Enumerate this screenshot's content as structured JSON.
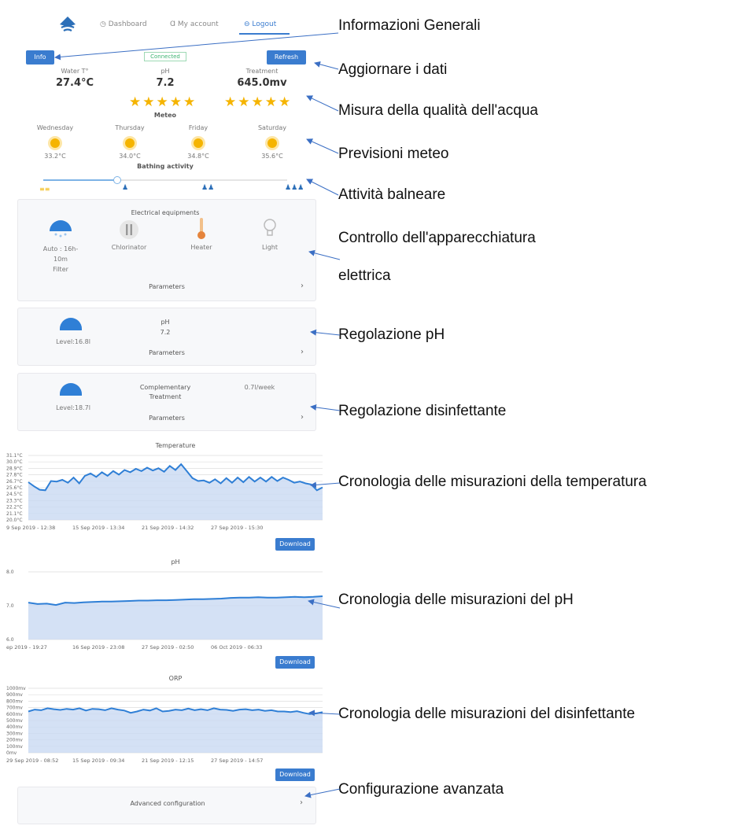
{
  "nav": {
    "dashboard": "Dashboard",
    "account": "My account",
    "logout": "Logout"
  },
  "top": {
    "info": "Info",
    "connected": "Connected",
    "refresh": "Refresh"
  },
  "measures": [
    {
      "label": "Water T°",
      "value": "27.4°C"
    },
    {
      "label": "pH",
      "value": "7.2"
    },
    {
      "label": "Treatment",
      "value": "645.0mv"
    }
  ],
  "stars": {
    "left": "★★★★★",
    "right": "★★★★★"
  },
  "meteo": {
    "title": "Meteo",
    "days": [
      {
        "name": "Wednesday",
        "temp": "33.2°C"
      },
      {
        "name": "Thursday",
        "temp": "34.0°C"
      },
      {
        "name": "Friday",
        "temp": "34.8°C"
      },
      {
        "name": "Saturday",
        "temp": "35.6°C"
      }
    ]
  },
  "bathing": {
    "title": "Bathing activity",
    "level": 0.3,
    "glyphs": [
      "≡≡",
      "♟",
      "♟♟",
      "♟♟♟"
    ]
  },
  "electrical": {
    "title": "Electrical equipments",
    "filter": {
      "line1": "Auto : 16h-",
      "line2": "10m",
      "line3": "Filter"
    },
    "chlorinator": "Chlorinator",
    "heater": "Heater",
    "light": "Light",
    "parameters": "Parameters"
  },
  "ph_panel": {
    "level": "Level:16.8l",
    "label": "pH",
    "value": "7.2",
    "parameters": "Parameters"
  },
  "treat_panel": {
    "level": "Level:18.7l",
    "label1": "Complementary",
    "label2": "Treatment",
    "rate": "0.7l/week",
    "parameters": "Parameters"
  },
  "download": "Download",
  "advanced": "Advanced configuration",
  "annotations": {
    "a1": "Informazioni Generali",
    "a2": "Aggiornare i dati",
    "a3": "Misura della qualità dell'acqua",
    "a4": "Previsioni meteo",
    "a5": "Attività balneare",
    "a6a": "Controllo dell'apparecchiatura",
    "a6b": "elettrica",
    "a7": "Regolazione pH",
    "a8": "Regolazione disinfettante",
    "a9": "Cronologia delle misurazioni della temperatura",
    "a10": "Cronologia delle misurazioni del pH",
    "a11": "Cronologia delle misurazioni del disinfettante",
    "a12": "Configurazione avanzata"
  },
  "chart_data": [
    {
      "type": "area",
      "title": "Temperature",
      "yticks": [
        "31.1°C",
        "30.0°C",
        "28.9°C",
        "27.8°C",
        "26.7°C",
        "25.6°C",
        "24.5°C",
        "23.3°C",
        "22.2°C",
        "21.1°C",
        "20.0°C"
      ],
      "ylim": [
        20.0,
        31.1
      ],
      "xticks": [
        "9 Sep 2019 - 12:38",
        "15 Sep 2019 - 13:34",
        "21 Sep 2019 - 14:32",
        "27 Sep 2019 - 15:30"
      ],
      "values": [
        26.5,
        25.8,
        25.2,
        25.1,
        26.7,
        26.6,
        26.9,
        26.4,
        27.3,
        26.3,
        27.6,
        28.0,
        27.4,
        28.2,
        27.6,
        28.4,
        27.8,
        28.6,
        28.2,
        28.8,
        28.4,
        29.0,
        28.5,
        28.9,
        28.3,
        29.3,
        28.6,
        29.6,
        28.4,
        27.2,
        26.7,
        26.8,
        26.4,
        27.0,
        26.3,
        27.2,
        26.4,
        27.3,
        26.5,
        27.4,
        26.6,
        27.3,
        26.6,
        27.4,
        26.7,
        27.3,
        26.9,
        26.4,
        26.6,
        26.3,
        26.1,
        25.1,
        25.6
      ]
    },
    {
      "type": "area",
      "title": "pH",
      "yticks": [
        "8.0",
        "7.0",
        "6.0"
      ],
      "ylim": [
        6.0,
        8.0
      ],
      "xticks": [
        "ep 2019 - 19:27",
        "16 Sep 2019 - 23:08",
        "27 Sep 2019 - 02:50",
        "06 Oct 2019 - 06:33"
      ],
      "values": [
        7.09,
        7.05,
        7.06,
        7.02,
        7.09,
        7.08,
        7.1,
        7.11,
        7.12,
        7.12,
        7.13,
        7.14,
        7.15,
        7.15,
        7.16,
        7.16,
        7.17,
        7.18,
        7.19,
        7.19,
        7.2,
        7.21,
        7.23,
        7.24,
        7.24,
        7.25,
        7.24,
        7.24,
        7.25,
        7.26,
        7.25,
        7.26,
        7.28
      ]
    },
    {
      "type": "area",
      "title": "ORP",
      "yticks": [
        "1000mv",
        "900mv",
        "800mv",
        "700mv",
        "600mv",
        "500mv",
        "400mv",
        "300mv",
        "200mv",
        "100mv",
        "0mv"
      ],
      "ylim": [
        0,
        1000
      ],
      "xticks": [
        "29 Sep 2019 - 08:52",
        "15 Sep 2019 - 09:34",
        "21 Sep 2019 - 12:15",
        "27 Sep 2019 - 14:57"
      ],
      "values": [
        640,
        670,
        660,
        690,
        675,
        665,
        680,
        670,
        690,
        655,
        680,
        675,
        660,
        690,
        670,
        655,
        620,
        640,
        670,
        655,
        690,
        640,
        650,
        670,
        660,
        685,
        660,
        675,
        660,
        690,
        670,
        665,
        650,
        670,
        675,
        660,
        670,
        650,
        660,
        640,
        640,
        630,
        645,
        620,
        600,
        610,
        630
      ]
    }
  ]
}
